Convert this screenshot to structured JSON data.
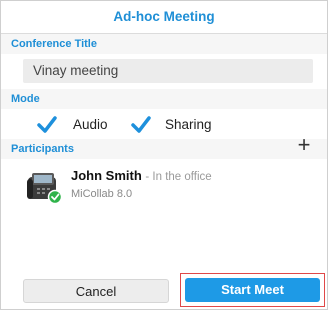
{
  "dialog": {
    "title": "Ad-hoc Meeting"
  },
  "conference": {
    "section_label": "Conference Title",
    "value": "Vinay meeting"
  },
  "mode": {
    "section_label": "Mode",
    "options": [
      {
        "label": "Audio",
        "checked": true
      },
      {
        "label": "Sharing",
        "checked": true
      }
    ]
  },
  "participants": {
    "section_label": "Participants",
    "add_icon": "plus-icon",
    "items": [
      {
        "name": "John Smith",
        "status": "- In the office",
        "app": "MiCollab 8.0",
        "presence": "available"
      }
    ]
  },
  "actions": {
    "cancel_label": "Cancel",
    "start_label": "Start Meet"
  },
  "colors": {
    "accent": "#1f8fd6",
    "primary_button": "#1e9ae6",
    "highlight": "#e04848",
    "presence": "#2fb34a"
  }
}
